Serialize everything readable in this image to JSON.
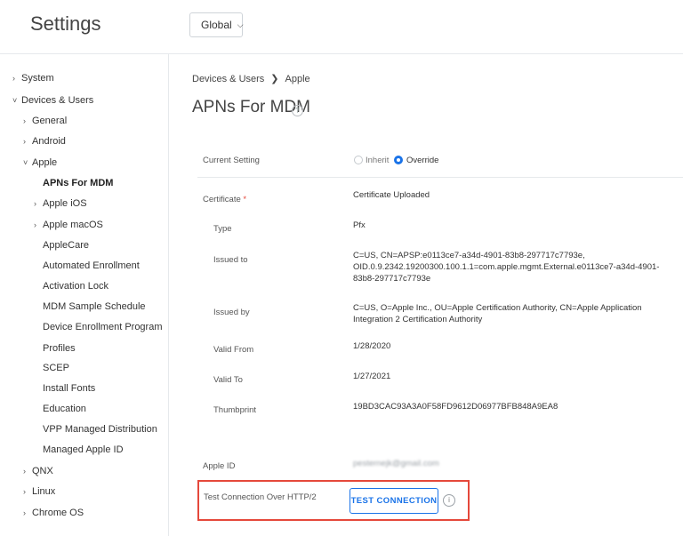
{
  "header": {
    "title": "Settings",
    "scope_select": "Global"
  },
  "sidebar": {
    "items": [
      {
        "label": "System",
        "caret": "›"
      },
      {
        "label": "Devices & Users",
        "caret": "˅"
      },
      {
        "label": "General",
        "caret": "›"
      },
      {
        "label": "Android",
        "caret": "›"
      },
      {
        "label": "Apple",
        "caret": "˅"
      },
      {
        "label": "APNs For MDM",
        "caret": ""
      },
      {
        "label": "Apple iOS",
        "caret": "›"
      },
      {
        "label": "Apple macOS",
        "caret": "›"
      },
      {
        "label": "AppleCare",
        "caret": ""
      },
      {
        "label": "Automated Enrollment",
        "caret": ""
      },
      {
        "label": "Activation Lock",
        "caret": ""
      },
      {
        "label": "MDM Sample Schedule",
        "caret": ""
      },
      {
        "label": "Device Enrollment Program",
        "caret": ""
      },
      {
        "label": "Profiles",
        "caret": ""
      },
      {
        "label": "SCEP",
        "caret": ""
      },
      {
        "label": "Install Fonts",
        "caret": ""
      },
      {
        "label": "Education",
        "caret": ""
      },
      {
        "label": "VPP Managed Distribution",
        "caret": ""
      },
      {
        "label": "Managed Apple ID",
        "caret": ""
      },
      {
        "label": "QNX",
        "caret": "›"
      },
      {
        "label": "Linux",
        "caret": "›"
      },
      {
        "label": "Chrome OS",
        "caret": "›"
      }
    ],
    "selected": "APNs For MDM"
  },
  "breadcrumb": {
    "parent": "Devices & Users",
    "separator": "❯",
    "current": "Apple"
  },
  "page": {
    "title": "APNs For MDM",
    "help_icon": "?",
    "current_setting": {
      "label": "Current Setting",
      "option_inherit": "Inherit",
      "option_override": "Override",
      "selected": "Override"
    },
    "certificate": {
      "label": "Certificate",
      "required_mark": "*",
      "status": "Certificate Uploaded",
      "type_label": "Type",
      "type_value": "Pfx",
      "issued_to_label": "Issued to",
      "issued_to_value": "C=US, CN=APSP:e0113ce7-a34d-4901-83b8-297717c7793e, OID.0.9.2342.19200300.100.1.1=com.apple.mgmt.External.e0113ce7-a34d-4901-83b8-297717c7793e",
      "issued_by_label": "Issued by",
      "issued_by_value": "C=US, O=Apple Inc., OU=Apple Certification Authority, CN=Apple Application Integration 2 Certification Authority",
      "valid_from_label": "Valid From",
      "valid_from_value": "1/28/2020",
      "valid_to_label": "Valid To",
      "valid_to_value": "1/27/2021",
      "thumbprint_label": "Thumbprint",
      "thumbprint_value": "19BD3CAC93A3A0F58FD9612D06977BFB848A9EA8"
    },
    "apple_id": {
      "label": "Apple ID",
      "value": "pesternejk@gmail.com"
    },
    "test_connection": {
      "label": "Test Connection Over HTTP/2",
      "button": "TEST CONNECTION",
      "info_icon": "i"
    }
  },
  "colors": {
    "accent": "#1a73e8",
    "highlight_border": "#e5483b",
    "required": "#e5483b"
  }
}
